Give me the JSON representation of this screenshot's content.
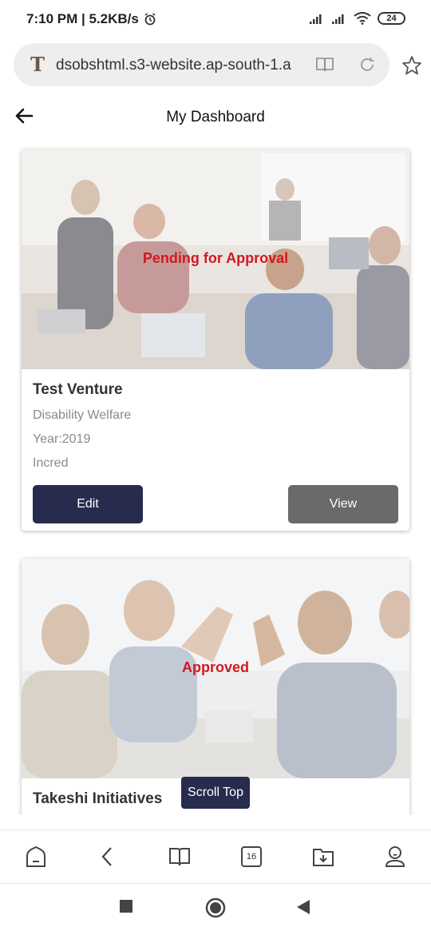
{
  "status_bar": {
    "time_speed": "7:10 PM | 5.2KB/s",
    "battery": "24"
  },
  "browser": {
    "url": "dsobshtml.s3-website.ap-south-1.a",
    "tabs_count": "16"
  },
  "header": {
    "title": "My Dashboard"
  },
  "cards": [
    {
      "status": "Pending for Approval",
      "title": "Test Venture",
      "category": "Disability Welfare",
      "year": "Year:2019",
      "organization": "Incred",
      "edit_label": "Edit",
      "view_label": "View"
    },
    {
      "status": "Approved",
      "title": "Takeshi Initiatives"
    }
  ],
  "scroll_top_label": "Scroll Top",
  "colors": {
    "primary_button": "#272c4e",
    "secondary_button": "#6a6a6a",
    "status_text": "#d0191e"
  }
}
